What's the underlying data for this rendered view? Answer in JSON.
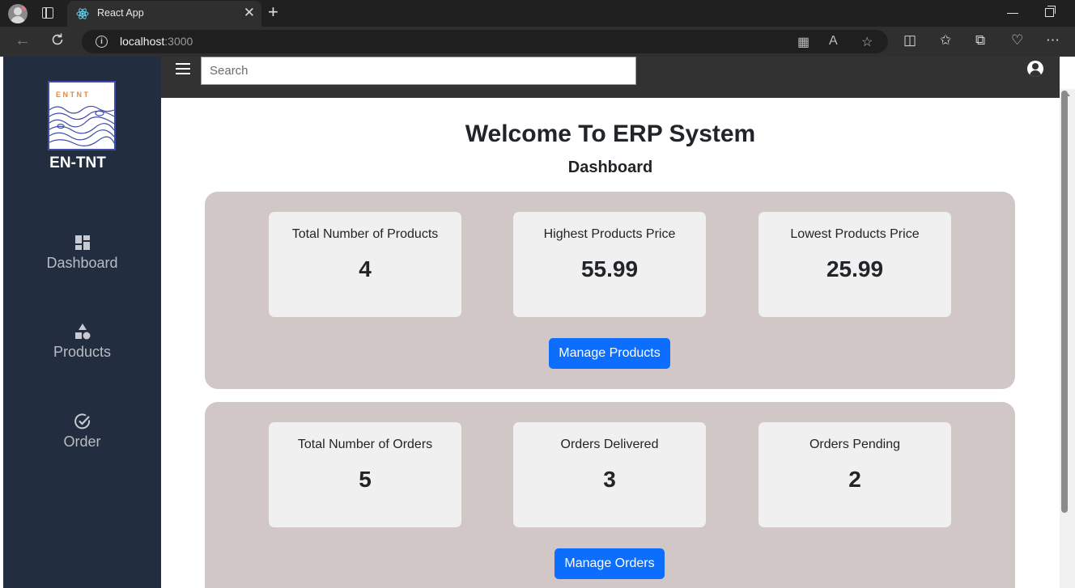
{
  "browser": {
    "tab_title": "React App",
    "url_host": "localhost",
    "url_port": ":3000"
  },
  "sidebar": {
    "logo_text": "ENTNT",
    "brand": "EN-TNT",
    "items": [
      {
        "label": "Dashboard",
        "icon": "dashboard-icon"
      },
      {
        "label": "Products",
        "icon": "shapes-icon"
      },
      {
        "label": "Order",
        "icon": "check-circle-icon"
      }
    ]
  },
  "topbar": {
    "search_placeholder": "Search"
  },
  "main": {
    "title": "Welcome To ERP System",
    "subtitle": "Dashboard",
    "products": {
      "cards": [
        {
          "label": "Total Number of Products",
          "value": "4"
        },
        {
          "label": "Highest Products Price",
          "value": "55.99"
        },
        {
          "label": "Lowest Products Price",
          "value": "25.99"
        }
      ],
      "button": "Manage Products"
    },
    "orders": {
      "cards": [
        {
          "label": "Total Number of Orders",
          "value": "5"
        },
        {
          "label": "Orders Delivered",
          "value": "3"
        },
        {
          "label": "Orders Pending",
          "value": "2"
        }
      ],
      "button": "Manage Orders"
    }
  },
  "colors": {
    "sidebar_bg": "#222d3f",
    "topbar_bg": "#323232",
    "panel_bg": "#d1c7c7",
    "card_bg": "#f0f0f0",
    "button_bg": "#0d6efd"
  }
}
